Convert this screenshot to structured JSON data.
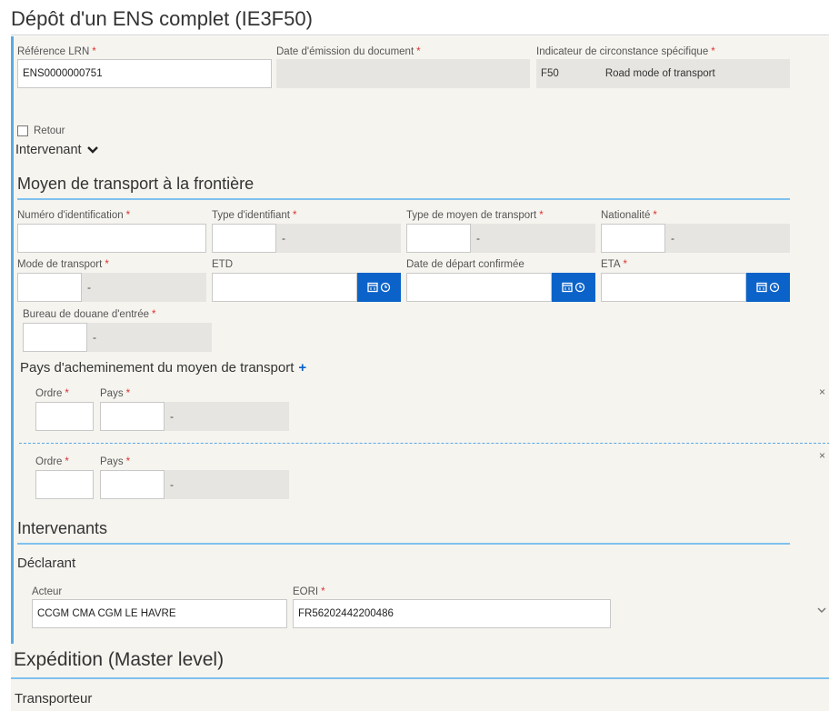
{
  "page": {
    "title": "Dépôt d'un ENS complet (IE3F50)"
  },
  "header_fields": {
    "lrn_label": "Référence LRN",
    "lrn_value": "ENS0000000751",
    "date_label": "Date d'émission du document",
    "indicator_label": "Indicateur de circonstance spécifique",
    "indicator_code": "F50",
    "indicator_text": "Road mode of transport",
    "required_mark": "*"
  },
  "retour": {
    "label": "Retour"
  },
  "intervenant_toggle": {
    "label": "Intervenant"
  },
  "transport": {
    "title": "Moyen de transport à la frontière",
    "num_label": "Numéro d'identification",
    "type_ident_label": "Type d'identifiant",
    "type_moyen_label": "Type de moyen de transport",
    "nationalite_label": "Nationalité",
    "mode_label": "Mode de transport",
    "etd_label": "ETD",
    "date_depart_label": "Date de départ confirmée",
    "eta_label": "ETA",
    "bureau_label": "Bureau de douane d'entrée",
    "dash": "-"
  },
  "pays": {
    "title": "Pays d'acheminement du moyen de transport",
    "plus": "+",
    "ordre_label": "Ordre",
    "pays_label": "Pays",
    "close": "×"
  },
  "intervenants": {
    "title": "Intervenants",
    "declarant_title": "Déclarant",
    "acteur_label": "Acteur",
    "acteur_value": "CCGM CMA CGM LE HAVRE",
    "eori_label": "EORI",
    "eori_value": "FR56202442200486"
  },
  "expedition": {
    "title": "Expédition (Master level)",
    "transporteur": "Transporteur"
  },
  "colors": {
    "accent": "#0b63c9",
    "rule": "#80c1ee",
    "required": "#d33"
  }
}
